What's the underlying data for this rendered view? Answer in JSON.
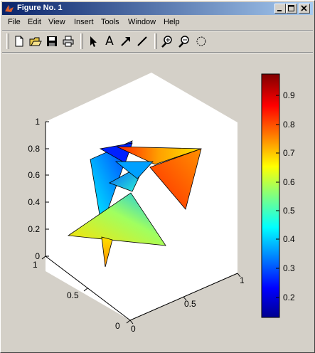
{
  "window": {
    "title": "Figure No. 1"
  },
  "menu": {
    "items": [
      "File",
      "Edit",
      "View",
      "Insert",
      "Tools",
      "Window",
      "Help"
    ]
  },
  "toolbar": {
    "buttons": [
      "new-figure",
      "open-file",
      "save",
      "print",
      "select-arrow",
      "insert-text",
      "insert-arrow",
      "insert-line",
      "zoom-in",
      "zoom-out",
      "rotate-3d"
    ],
    "text_tool_label": "A"
  },
  "plot": {
    "z_ticks": [
      "0",
      "0.2",
      "0.4",
      "0.6",
      "0.8",
      "1"
    ],
    "x_ticks": [
      "0",
      "0.5",
      "1"
    ],
    "y_ticks": [
      "0",
      "0.5",
      "1"
    ]
  },
  "colorbar": {
    "ticks": [
      "0.2",
      "0.3",
      "0.4",
      "0.5",
      "0.6",
      "0.7",
      "0.8",
      "0.9"
    ],
    "range": [
      0.13,
      0.98
    ]
  },
  "colors": {
    "figure_bg": "#d4d0c8",
    "axes_bg": "#ffffff",
    "title_start": "#0a246a",
    "title_end": "#a6caf0"
  }
}
